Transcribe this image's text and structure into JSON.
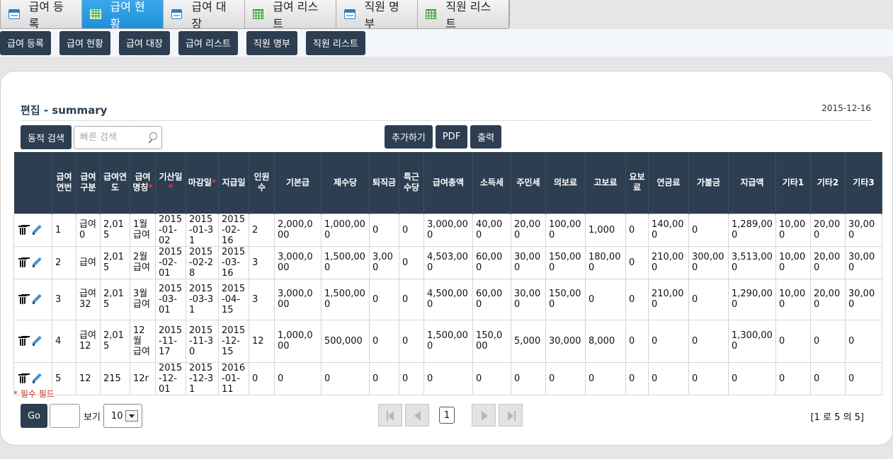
{
  "tabs": [
    {
      "label": "급여 등록",
      "icon": "form-icon",
      "active": false
    },
    {
      "label": "급여 현황",
      "icon": "grid-icon",
      "active": true
    },
    {
      "label": "급여 대장",
      "icon": "form-icon",
      "active": false
    },
    {
      "label": "급여 리스트",
      "icon": "grid-icon",
      "active": false
    },
    {
      "label": "직원 명부",
      "icon": "form-icon",
      "active": false
    },
    {
      "label": "직원 리스트",
      "icon": "grid-icon",
      "active": false
    }
  ],
  "subnav": [
    "급여 등록",
    "급여 현황",
    "급여 대장",
    "급여 리스트",
    "직원 명부",
    "직원 리스트"
  ],
  "panel": {
    "title": "편집 - summary",
    "date": "2015-12-16",
    "dynamic_search_label": "동적 검색",
    "quick_search_placeholder": "빠른 검색",
    "add_label": "추가하기",
    "pdf_label": "PDF",
    "print_label": "출력"
  },
  "columns": [
    {
      "label": "",
      "width": 54
    },
    {
      "label": "급여연번",
      "width": 34
    },
    {
      "label": "급여구분",
      "width": 34
    },
    {
      "label": "급여연도",
      "width": 42
    },
    {
      "label": "급여명칭",
      "width": 36,
      "required": true
    },
    {
      "label": "기산일",
      "width": 43,
      "required": true
    },
    {
      "label": "마감일",
      "width": 46,
      "required": true
    },
    {
      "label": "지급일",
      "width": 43
    },
    {
      "label": "인원수",
      "width": 36
    },
    {
      "label": "기본급",
      "width": 66
    },
    {
      "label": "제수당",
      "width": 68
    },
    {
      "label": "퇴직금",
      "width": 42
    },
    {
      "label": "특근수당",
      "width": 35
    },
    {
      "label": "급여총액",
      "width": 69
    },
    {
      "label": "소득세",
      "width": 54
    },
    {
      "label": "주민세",
      "width": 49
    },
    {
      "label": "의보료",
      "width": 56
    },
    {
      "label": "고보료",
      "width": 57
    },
    {
      "label": "요보료",
      "width": 32
    },
    {
      "label": "연금료",
      "width": 57
    },
    {
      "label": "가불금",
      "width": 56
    },
    {
      "label": "지급액",
      "width": 67
    },
    {
      "label": "기타1",
      "width": 49
    },
    {
      "label": "기타2",
      "width": 49
    },
    {
      "label": "기타3",
      "width": 52
    }
  ],
  "rows": [
    [
      "1",
      "급여0",
      "2,015",
      "1월 급여",
      "2015-01-02",
      "2015-01-31",
      "2015-02-16",
      "2",
      "2,000,000",
      "1,000,000",
      "0",
      "0",
      "3,000,000",
      "40,000",
      "20,000",
      "100,000",
      "1,000",
      "0",
      "140,000",
      "0",
      "1,289,000",
      "10,000",
      "20,000",
      "30,000"
    ],
    [
      "2",
      "급여",
      "2,015",
      "2월 급여",
      "2015-02-01",
      "2015-02-28",
      "2015-03-16",
      "3",
      "3,000,000",
      "1,500,000",
      "3,000",
      "0",
      "4,503,000",
      "60,000",
      "30,000",
      "150,000",
      "180,000",
      "0",
      "210,000",
      "300,000",
      "3,513,000",
      "10,000",
      "20,000",
      "30,000"
    ],
    [
      "3",
      "급여32",
      "2,015",
      "3월 급여",
      "2015-03-01",
      "2015-03-31",
      "2015-04-15",
      "3",
      "3,000,000",
      "1,500,000",
      "0",
      "0",
      "4,500,000",
      "60,000",
      "30,000",
      "150,000",
      "0",
      "0",
      "210,000",
      "0",
      "1,290,000",
      "10,000",
      "20,000",
      "30,000"
    ],
    [
      "4",
      "급여12",
      "2,015",
      "12월 급여",
      "2015-11-17",
      "2015-11-30",
      "2015-12-15",
      "12",
      "1,000,000",
      "500,000",
      "0",
      "0",
      "1,500,000",
      "150,000",
      "5,000",
      "30,000",
      "8,000",
      "0",
      "0",
      "0",
      "1,300,000",
      "0",
      "0",
      "0"
    ],
    [
      "5",
      "12",
      "215",
      "12r",
      "2015-12-01",
      "2015-12-31",
      "2016-01-11",
      "0",
      "0",
      "0",
      "0",
      "0",
      "0",
      "0",
      "0",
      "0",
      "0",
      "0",
      "0",
      "0",
      "0",
      "0",
      "0",
      "0"
    ]
  ],
  "footer": {
    "required_note": "* 필수 필드",
    "go_label": "Go",
    "show_label": "보기",
    "page_size": "10",
    "current_page": "1",
    "range_info": "[1 로 5 의 5]"
  },
  "colors": {
    "header_bg": "#2c3e50",
    "active_tab": "#2196e0",
    "required": "#e53935"
  }
}
